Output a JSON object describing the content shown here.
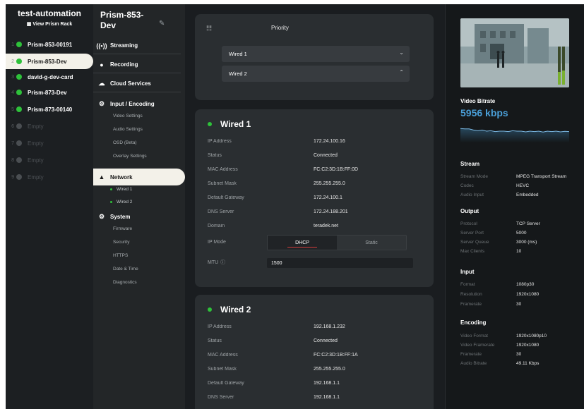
{
  "rack": {
    "title": "test-automation",
    "view_link": "View Prism Rack",
    "items": [
      {
        "num": "1",
        "label": "Prism-853-00191",
        "state": "online"
      },
      {
        "num": "2",
        "label": "Prism-853-Dev",
        "state": "online",
        "active": true
      },
      {
        "num": "3",
        "label": "david-g-dev-card",
        "state": "online"
      },
      {
        "num": "4",
        "label": "Prism-873-Dev",
        "state": "online"
      },
      {
        "num": "5",
        "label": "Prism-873-00140",
        "state": "online"
      },
      {
        "num": "6",
        "label": "Empty",
        "state": "empty"
      },
      {
        "num": "7",
        "label": "Empty",
        "state": "empty"
      },
      {
        "num": "8",
        "label": "Empty",
        "state": "empty"
      },
      {
        "num": "9",
        "label": "Empty",
        "state": "empty"
      }
    ]
  },
  "nav": {
    "device_title": "Prism-853-Dev",
    "streaming": "Streaming",
    "recording": "Recording",
    "cloud_services": "Cloud Services",
    "input_encoding": "Input / Encoding",
    "video_settings": "Video Settings",
    "audio_settings": "Audio Settings",
    "osd": "OSD (Beta)",
    "overlay_settings": "Overlay Settings",
    "network": "Network",
    "wired1": "Wired 1",
    "wired2": "Wired 2",
    "system": "System",
    "firmware": "Firmware",
    "security": "Security",
    "https": "HTTPS",
    "date_time": "Date & Time",
    "diagnostics": "Diagnostics"
  },
  "priority": {
    "label": "Priority",
    "options": [
      "Wired 1",
      "Wired 2"
    ]
  },
  "wired1": {
    "title": "Wired 1",
    "ip_label": "IP Address",
    "ip": "172.24.100.16",
    "status_label": "Status",
    "status": "Connected",
    "mac_label": "MAC Address",
    "mac": "FC:C2:3D:1B:FF:0D",
    "mask_label": "Subnet Mask",
    "mask": "255.255.255.0",
    "gw_label": "Default Gateway",
    "gw": "172.24.100.1",
    "dns_label": "DNS Server",
    "dns": "172.24.188.201",
    "domain_label": "Domain",
    "domain": "teradek.net",
    "mode_label": "IP Mode",
    "mode_dhcp": "DHCP",
    "mode_static": "Static",
    "mtu_label": "MTU",
    "mtu": "1500"
  },
  "wired2": {
    "title": "Wired 2",
    "ip_label": "IP Address",
    "ip": "192.168.1.232",
    "status_label": "Status",
    "status": "Connected",
    "mac_label": "MAC Address",
    "mac": "FC:C2:3D:1B:FF:1A",
    "mask_label": "Subnet Mask",
    "mask": "255.255.255.0",
    "gw_label": "Default Gateway",
    "gw": "192.168.1.1",
    "dns_label": "DNS Server",
    "dns": "192.168.1.1"
  },
  "right": {
    "bitrate_title": "Video Bitrate",
    "bitrate_value": "5956 kbps",
    "bitrate_trend": [
      0.62,
      0.6,
      0.6,
      0.55,
      0.52,
      0.55,
      0.5,
      0.52,
      0.48,
      0.5,
      0.5,
      0.48,
      0.52,
      0.5,
      0.5,
      0.47,
      0.5,
      0.48,
      0.5,
      0.46,
      0.5,
      0.48,
      0.5,
      0.47,
      0.49,
      0.48
    ],
    "stream": {
      "title": "Stream",
      "mode_label": "Stream Mode",
      "mode": "MPEG Transport Stream",
      "codec_label": "Codec",
      "codec": "HEVC",
      "audio_label": "Audio Input",
      "audio": "Embedded"
    },
    "output": {
      "title": "Output",
      "protocol_label": "Protocol",
      "protocol": "TCP Server",
      "port_label": "Server Port",
      "port": "5000",
      "queue_label": "Server Queue",
      "queue": "3000 (ms)",
      "clients_label": "Max Clients",
      "clients": "10"
    },
    "input": {
      "title": "Input",
      "format_label": "Format",
      "format": "1080p30",
      "res_label": "Resolution",
      "res": "1920x1080",
      "fr_label": "Framerate",
      "fr": "30"
    },
    "encoding": {
      "title": "Encoding",
      "vf_label": "Video Format",
      "vf": "1920x1080p10",
      "vfr_label": "Video Framerate",
      "vfr": "1920x1080",
      "fr_label": "Framerate",
      "fr": "30",
      "ab_label": "Audio Bitrate",
      "ab": "49.11 Kbps"
    }
  },
  "colors": {
    "online": "#2ec13a",
    "accent_blue": "#4a9fd8",
    "active_bg": "#f3f1e9",
    "tab_underline": "#d23c3c"
  },
  "icons": [
    "grid-icon",
    "broadcast-icon",
    "record-icon",
    "cloud-icon",
    "gear-icon",
    "network-icon",
    "pencil-icon",
    "priority-icon",
    "chevron-down-icon",
    "chevron-up-icon",
    "info-icon"
  ]
}
